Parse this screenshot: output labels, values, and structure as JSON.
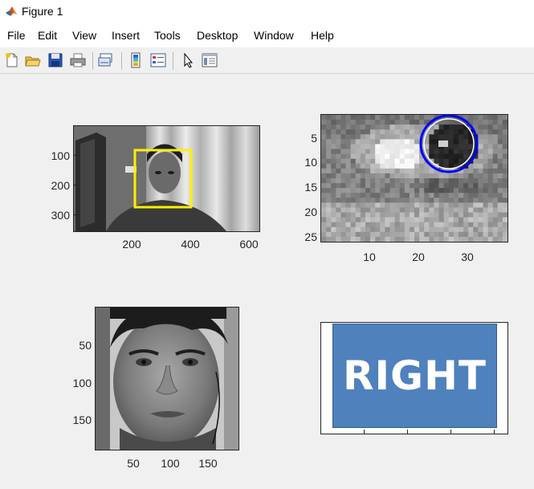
{
  "window": {
    "title": "Figure 1"
  },
  "menu": [
    "File",
    "Edit",
    "View",
    "Insert",
    "Tools",
    "Desktop",
    "Window",
    "Help"
  ],
  "toolbar": {
    "icons": [
      "new-figure-icon",
      "open-file-icon",
      "save-icon",
      "print-icon",
      "link-plot-icon",
      "insert-colorbar-icon",
      "insert-legend-icon",
      "edit-plot-icon",
      "property-inspector-icon"
    ]
  },
  "plots": {
    "webcam": {
      "xticks": [
        "200",
        "400",
        "600"
      ],
      "yticks": [
        "100",
        "200",
        "300"
      ],
      "box_color": "#ffef00"
    },
    "eye": {
      "xticks": [
        "10",
        "20",
        "30"
      ],
      "yticks": [
        "5",
        "10",
        "15",
        "20",
        "25"
      ],
      "circle_color": "#0000ff"
    },
    "face": {
      "xticks": [
        "50",
        "100",
        "150"
      ],
      "yticks": [
        "50",
        "100",
        "150"
      ]
    },
    "direction": {
      "label": "RIGHT",
      "banner_color": "#4f81bd"
    }
  }
}
